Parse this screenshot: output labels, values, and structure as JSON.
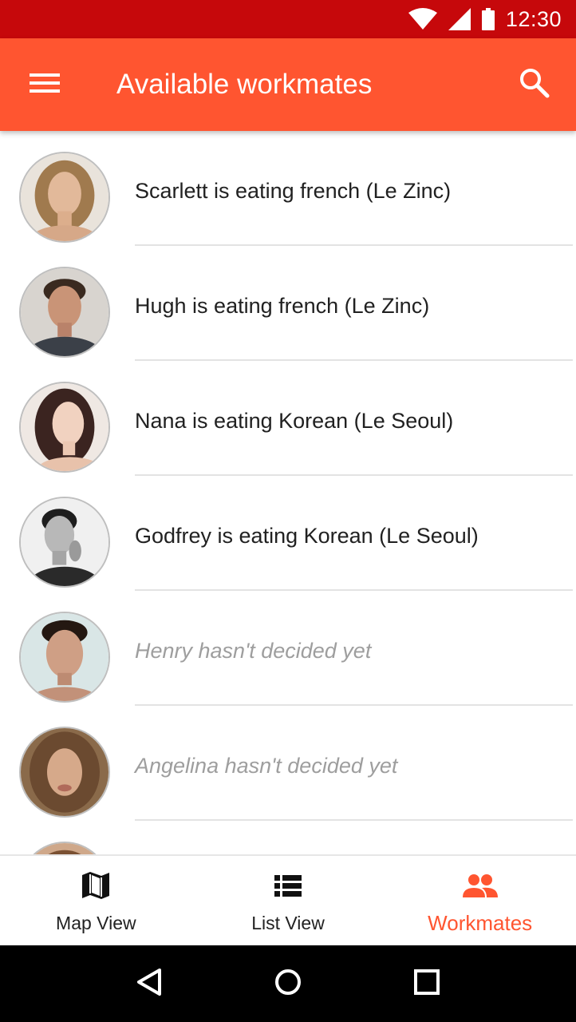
{
  "status_bar": {
    "time": "12:30"
  },
  "app_bar": {
    "title": "Available workmates",
    "menu_icon": "menu-icon",
    "search_icon": "search-icon"
  },
  "colors": {
    "primary": "#ff5530",
    "status_bar": "#c6080b",
    "undecided_text": "#9e9e9e"
  },
  "workmates": [
    {
      "text": "Scarlett is eating french (Le Zinc)",
      "decided": true,
      "avatar": "avatar-scarlett"
    },
    {
      "text": "Hugh is eating french (Le Zinc)",
      "decided": true,
      "avatar": "avatar-hugh"
    },
    {
      "text": "Nana is eating Korean (Le Seoul)",
      "decided": true,
      "avatar": "avatar-nana"
    },
    {
      "text": "Godfrey is eating Korean (Le Seoul)",
      "decided": true,
      "avatar": "avatar-godfrey"
    },
    {
      "text": "Henry hasn't decided yet",
      "decided": false,
      "avatar": "avatar-henry"
    },
    {
      "text": "Angelina hasn't decided yet",
      "decided": false,
      "avatar": "avatar-angelina"
    }
  ],
  "bottom_nav": [
    {
      "label": "Map View",
      "icon": "map-icon",
      "active": false
    },
    {
      "label": "List View",
      "icon": "list-icon",
      "active": false
    },
    {
      "label": "Workmates",
      "icon": "people-icon",
      "active": true
    }
  ]
}
